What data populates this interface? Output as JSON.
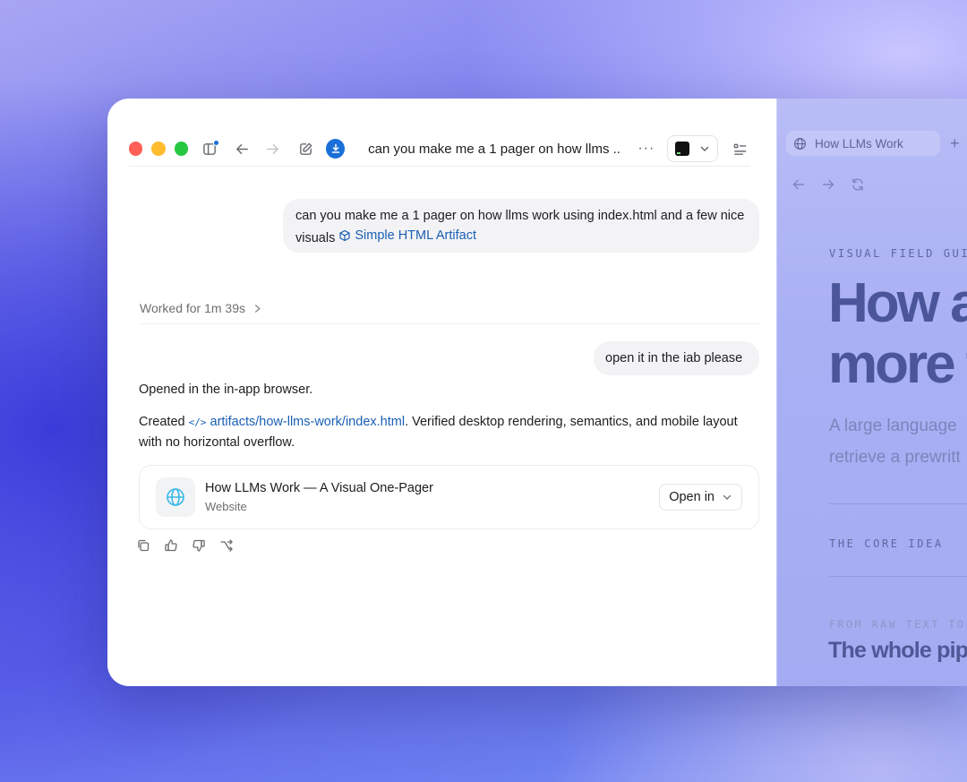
{
  "window": {
    "title": "can you make me a 1 pager on how llms ...",
    "more_label": "···"
  },
  "messages": {
    "user1_text": "can you make me a 1 pager on how llms work using index.html and a few nice visuals",
    "user1_attachment": "Simple HTML Artifact",
    "worked_for": "Worked for 1m 39s",
    "user2_text": "open it in the iab please",
    "response_line1": "Opened in the in-app browser.",
    "response_created": "Created",
    "response_path": "artifacts/how-llms-work/index.html",
    "response_rest": ". Verified desktop rendering, semantics, and mobile layout with no horizontal overflow."
  },
  "card": {
    "title": "How LLMs Work — A Visual One-Pager",
    "subtitle": "Website",
    "open_label": "Open in"
  },
  "browser": {
    "tab_title": "How LLMs Work",
    "plus_label": "+",
    "eyebrow": "VISUAL FIELD GUID",
    "headline_line1": "How a",
    "headline_line2": "more t",
    "sub_line1": "A large language",
    "sub_line2": "retrieve a prewritt",
    "section1": "THE CORE IDEA",
    "section2_eyebrow": "FROM RAW TEXT TO",
    "section2_title": "The whole pip"
  },
  "colors": {
    "accent": "#1a6fd8",
    "link": "#1a5fb4",
    "traffic_red": "#ff5f57",
    "traffic_yellow": "#febc2e",
    "traffic_green": "#28c840"
  },
  "icons": [
    "sidebar-icon",
    "back-arrow-icon",
    "forward-arrow-icon",
    "compose-icon",
    "download-icon",
    "terminal-icon",
    "chevron-down-icon",
    "list-icon",
    "cube-icon",
    "code-icon",
    "globe-icon",
    "copy-icon",
    "thumbs-up-icon",
    "thumbs-down-icon",
    "fork-icon",
    "reload-icon"
  ]
}
